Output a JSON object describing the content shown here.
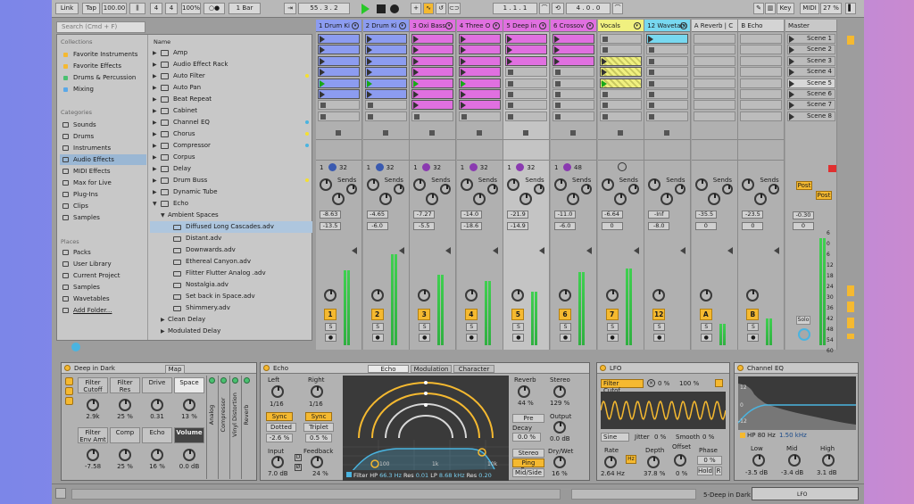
{
  "toolbar": {
    "link": "Link",
    "tap": "Tap",
    "tempo": "100.00",
    "sig_num": "4",
    "sig_den": "4",
    "zoom_pct": "100%",
    "rec_mode": "○●",
    "quant": "1 Bar",
    "position": "55 . 3 . 2",
    "loop_start": "1 . 1 . 1",
    "loop_len": "4 . 0 . 0",
    "key": "Key",
    "midi": "MIDI",
    "cpu": "27 %"
  },
  "browser": {
    "search_placeholder": "Search (Cmd + F)",
    "collections_title": "Collections",
    "categories_title": "Categories",
    "places_title": "Places",
    "name_header": "Name",
    "collections": [
      {
        "label": "Favorite Instruments",
        "color": "#f5b930"
      },
      {
        "label": "Favorite Effects",
        "color": "#f5b930"
      },
      {
        "label": "Drums & Percussion",
        "color": "#4ac070"
      },
      {
        "label": "Mixing",
        "color": "#5aa8e8"
      }
    ],
    "categories": [
      "Sounds",
      "Drums",
      "Instruments",
      "Audio Effects",
      "MIDI Effects",
      "Max for Live",
      "Plug-Ins",
      "Clips",
      "Samples"
    ],
    "places": [
      "Packs",
      "User Library",
      "Current Project",
      "Samples",
      "Wavetables",
      "Add Folder..."
    ],
    "items": [
      {
        "label": "Amp",
        "dot": ""
      },
      {
        "label": "Audio Effect Rack",
        "dot": ""
      },
      {
        "label": "Auto Filter",
        "dot": "#f5e030"
      },
      {
        "label": "Auto Pan",
        "dot": ""
      },
      {
        "label": "Beat Repeat",
        "dot": ""
      },
      {
        "label": "Cabinet",
        "dot": ""
      },
      {
        "label": "Channel EQ",
        "dot": "#4ab4e0"
      },
      {
        "label": "Chorus",
        "dot": "#f5e030"
      },
      {
        "label": "Compressor",
        "dot": "#4ab4e0"
      },
      {
        "label": "Corpus",
        "dot": ""
      },
      {
        "label": "Delay",
        "dot": ""
      },
      {
        "label": "Drum Buss",
        "dot": "#f5e030"
      },
      {
        "label": "Dynamic Tube",
        "dot": ""
      },
      {
        "label": "Echo",
        "dot": ""
      }
    ],
    "subfolder": "Ambient Spaces",
    "presets": [
      "Diffused Long Cascades.adv",
      "Distant.adv",
      "Downwards.adv",
      "Ethereal Canyon.adv",
      "Flitter Flutter Analog .adv",
      "Nostalgia.adv",
      "Set back in Space.adv",
      "Shimmery.adv"
    ],
    "after": [
      "Clean Delay",
      "Modulated Delay"
    ]
  },
  "tracks": [
    {
      "name": "1 Drum Ki",
      "color": "#8c9cf0",
      "clips": 6,
      "play": "4",
      "num": "1",
      "vol": "-8.63",
      "pan": "-13.5",
      "sendval": "32",
      "m": 0.7
    },
    {
      "name": "2 Drum Ki",
      "color": "#8c9cf0",
      "clips": 6,
      "play": "4",
      "num": "2",
      "vol": "-4.65",
      "pan": "-6.0",
      "sendval": "32",
      "m": 0.85
    },
    {
      "name": "3 Oxi Bass",
      "color": "#e070e0",
      "clips": 7,
      "play": "4",
      "num": "3",
      "vol": "-7.27",
      "pan": "-5.5",
      "sendval": "32",
      "m": 0.66
    },
    {
      "name": "4 Three O",
      "color": "#e070e0",
      "clips": 7,
      "play": "4",
      "num": "4",
      "vol": "-14.0",
      "pan": "-18.6",
      "sendval": "32",
      "m": 0.6
    },
    {
      "name": "5 Deep in",
      "color": "#e070e0",
      "clips": 3,
      "play": "4",
      "num": "5",
      "vol": "-21.9",
      "pan": "-14.9",
      "sendval": "32",
      "m": 0.5
    },
    {
      "name": "6 Crossov",
      "color": "#e070e0",
      "clips": 3,
      "play": "4",
      "num": "6",
      "vol": "-11.0",
      "pan": "-6.0",
      "sendval": "48",
      "m": 0.68
    },
    {
      "name": "Vocals",
      "color": "#f0f080",
      "clips": 3,
      "play": "4",
      "num": "7",
      "vol": "-6.64",
      "pan": "0",
      "sendval": "",
      "m": 0.72
    },
    {
      "name": "12 Wavetabl",
      "color": "#78d8f0",
      "clips": 1,
      "play": "0",
      "num": "12",
      "vol": "-Inf",
      "pan": "-8.0",
      "sendval": "",
      "m": 0.0
    },
    {
      "name": "A Reverb | C",
      "color": "#d4d4d4",
      "clips": 0,
      "play": "",
      "num": "A",
      "vol": "-35.5",
      "pan": "0",
      "sendval": "",
      "m": 0.2
    },
    {
      "name": "B Echo",
      "color": "#d4d4d4",
      "clips": 0,
      "play": "",
      "num": "B",
      "vol": "-23.5",
      "pan": "0",
      "sendval": "",
      "m": 0.25
    }
  ],
  "sends_label": "Sends",
  "master": {
    "name": "Master",
    "scenes": [
      "Scene 1",
      "Scene 2",
      "Scene 3",
      "Scene 4",
      "Scene 5",
      "Scene 6",
      "Scene 7",
      "Scene 8"
    ],
    "vol": "-0.30",
    "pan": "0",
    "post1": "Post",
    "post2": "Post",
    "solo": "Solo",
    "scale": [
      "6",
      "0",
      "6",
      "12",
      "18",
      "24",
      "30",
      "36",
      "42",
      "48",
      "54",
      "60"
    ]
  },
  "rack": {
    "title": "Deep in Dark",
    "map": "Map",
    "macros": [
      {
        "l": "Filter Cutoff",
        "v": "2.9k"
      },
      {
        "l": "Filter Res",
        "v": "25 %"
      },
      {
        "l": "Drive",
        "v": "0.31"
      },
      {
        "l": "Space",
        "v": "13 %"
      },
      {
        "l": "Filter Env Amt",
        "v": "-7.58"
      },
      {
        "l": "Comp",
        "v": "25 %"
      },
      {
        "l": "Echo",
        "v": "16 %"
      },
      {
        "l": "Volume",
        "v": "0.0 dB"
      }
    ],
    "chain": [
      "Analog",
      "Compressor",
      "Vinyl Distortion",
      "Reverb"
    ]
  },
  "echo": {
    "title": "Echo",
    "tabs": [
      "Echo",
      "Modulation",
      "Character"
    ],
    "left": "Left",
    "right": "Right",
    "lval": "1/16",
    "rval": "1/16",
    "sync": "Sync",
    "mode_l": "Dotted",
    "mode_r": "Triplet",
    "off_l": "-2.6 %",
    "off_r": "0.5 %",
    "input": "Input",
    "inval": "7.0 dB",
    "feedback": "Feedback",
    "fbval": "24 %",
    "reverb": "Reverb",
    "rvval": "44 %",
    "stereo": "Stereo",
    "stval": "129 %",
    "pre": "Pre",
    "decay": "Decay",
    "decval": "0.0 %",
    "output": "Output",
    "outval": "0.0 dB",
    "stbtn": "Stereo",
    "pingpong": "Ping Pong",
    "midside": "Mid/Side",
    "drywet": "Dry/Wet",
    "dwval": "16 %",
    "axis": [
      "100",
      "1k",
      "10k"
    ],
    "filter": "Filter",
    "hp": "HP",
    "hpval": "66.3 Hz",
    "res": "Res",
    "resval": "0.01",
    "lp": "LP",
    "lpval": "8.68 kHz",
    "res2val": "0.20"
  },
  "lfo": {
    "title": "LFO",
    "target": "Filter Cutof...",
    "pct1": "0 %",
    "pct2": "100 %",
    "shape": "Sine",
    "jitter": "Jitter",
    "jval": "0 %",
    "smooth": "Smooth",
    "sval": "0 %",
    "rate": "Rate",
    "rval": "2.64 Hz",
    "hz": "Hz",
    "depth": "Depth",
    "dval": "37.8 %",
    "offset": "Offset",
    "oval": "0 %",
    "phase": "Phase",
    "pval": "0 %",
    "hold": "Hold",
    "r": "R"
  },
  "eq": {
    "title": "Channel EQ",
    "scale": [
      "12",
      "0",
      "-12"
    ],
    "hp": "HP 80 Hz",
    "freq": "1.50 kHz",
    "low": "Low",
    "lval": "-3.5 dB",
    "mid": "Mid",
    "mval": "-3.4 dB",
    "high": "High",
    "hval": "3.1 dB"
  },
  "status": {
    "track": "5-Deep in Dark",
    "lfo": "LFO"
  }
}
